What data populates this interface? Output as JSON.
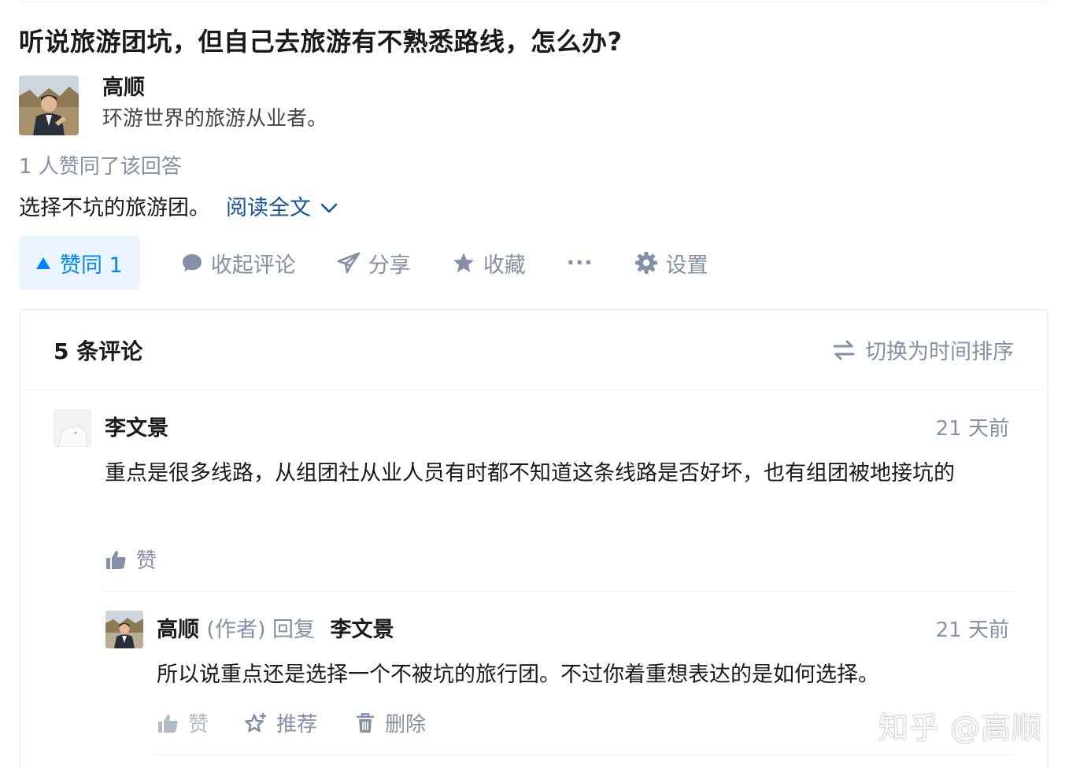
{
  "question": {
    "title": "听说旅游团坑，但自己去旅游有不熟悉路线，怎么办?"
  },
  "author": {
    "name": "高顺",
    "bio": "环游世界的旅游从业者。",
    "avatar_icon": "profile-photo"
  },
  "answer": {
    "voters_text": "1 人赞同了该回答",
    "excerpt": "选择不坑的旅游团。",
    "read_more": "阅读全文"
  },
  "actions": {
    "vote_label": "赞同 1",
    "collapse_comments": "收起评论",
    "share": "分享",
    "favorite": "收藏",
    "more": "···",
    "settings": "设置"
  },
  "comments": {
    "count_label": "5 条评论",
    "sort_label": "切换为时间排序",
    "items": [
      {
        "author": "李文景",
        "time": "21 天前",
        "text": "重点是很多线路，从组团社从业人员有时都不知道这条线路是否好坏，也有组团被地接坑的",
        "like_label": "赞"
      }
    ],
    "reply": {
      "author": "高顺",
      "author_tag": "(作者) 回复",
      "reply_to": "李文景",
      "time": "21 天前",
      "text": "所以说重点还是选择一个不被坑的旅行团。不过你着重想表达的是如何选择。",
      "like_label": "赞",
      "recommend_label": "推荐",
      "delete_label": "删除"
    }
  },
  "watermark": "知乎 @高顺",
  "colors": {
    "accent": "#0084ff",
    "link": "#175199",
    "muted": "#8590a6",
    "vote_bg": "#ebf5ff"
  }
}
